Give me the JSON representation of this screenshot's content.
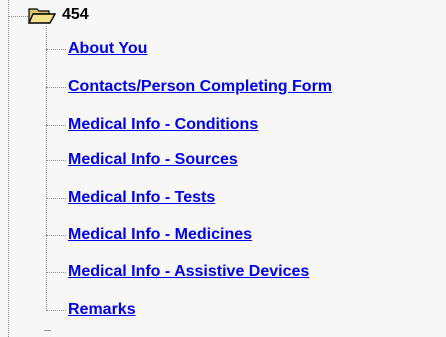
{
  "tree": {
    "root": {
      "label": "454",
      "icon": "open-folder-icon"
    },
    "items": [
      {
        "label": "About You"
      },
      {
        "label": "Contacts/Person Completing Form"
      },
      {
        "label": "Medical Info - Conditions"
      },
      {
        "label": "Medical Info - Sources"
      },
      {
        "label": "Medical Info - Tests"
      },
      {
        "label": "Medical Info - Medicines"
      },
      {
        "label": "Medical Info - Assistive Devices"
      },
      {
        "label": "Remarks"
      }
    ],
    "colors": {
      "link": "#0000ee",
      "background": "#f7f7f7",
      "connector": "#8a8a8a"
    }
  }
}
